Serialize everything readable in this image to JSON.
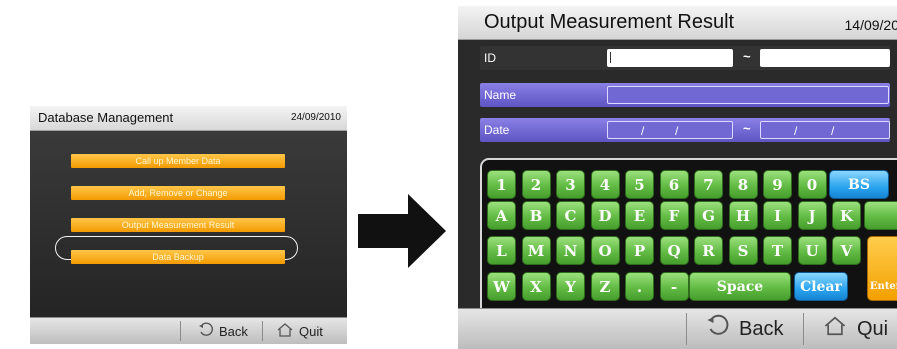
{
  "left_screen": {
    "title": "Database Management",
    "date": "24/09/2010",
    "menu": [
      {
        "label": "Call up Member Data"
      },
      {
        "label": "Add, Remove or Change"
      },
      {
        "label": "Output Measurement Result"
      },
      {
        "label": "Data Backup"
      }
    ],
    "selected_index": 2,
    "footer": {
      "back_label": "Back",
      "quit_label": "Quit"
    }
  },
  "right_screen": {
    "title": "Output Measurement Result",
    "date": "14/09/20",
    "fields": {
      "id": {
        "label": "ID",
        "range_separator": "~",
        "from_value": "",
        "to_value": ""
      },
      "name": {
        "label": "Name",
        "value": ""
      },
      "date": {
        "label": "Date",
        "date_separator": "/",
        "range_separator": "~"
      }
    },
    "keyboard": {
      "rows": [
        [
          "1",
          "2",
          "3",
          "4",
          "5",
          "6",
          "7",
          "8",
          "9",
          "0"
        ],
        [
          "A",
          "B",
          "C",
          "D",
          "E",
          "F",
          "G",
          "H",
          "I",
          "J",
          "K"
        ],
        [
          "L",
          "M",
          "N",
          "O",
          "P",
          "Q",
          "R",
          "S",
          "T",
          "U",
          "V"
        ],
        [
          "W",
          "X",
          "Y",
          "Z",
          ".",
          "-"
        ]
      ],
      "bs_label": "BS",
      "space_label": "Space",
      "clear_label": "Clear",
      "enter_label": "Enter"
    },
    "footer": {
      "back_label": "Back",
      "quit_label": "Qui"
    }
  },
  "colors": {
    "menu_orange": "#f6a800",
    "field_purple": "#6c63d0",
    "key_green": "#5cb83f",
    "key_blue": "#2aa4ef",
    "key_orange": "#f3a000"
  }
}
